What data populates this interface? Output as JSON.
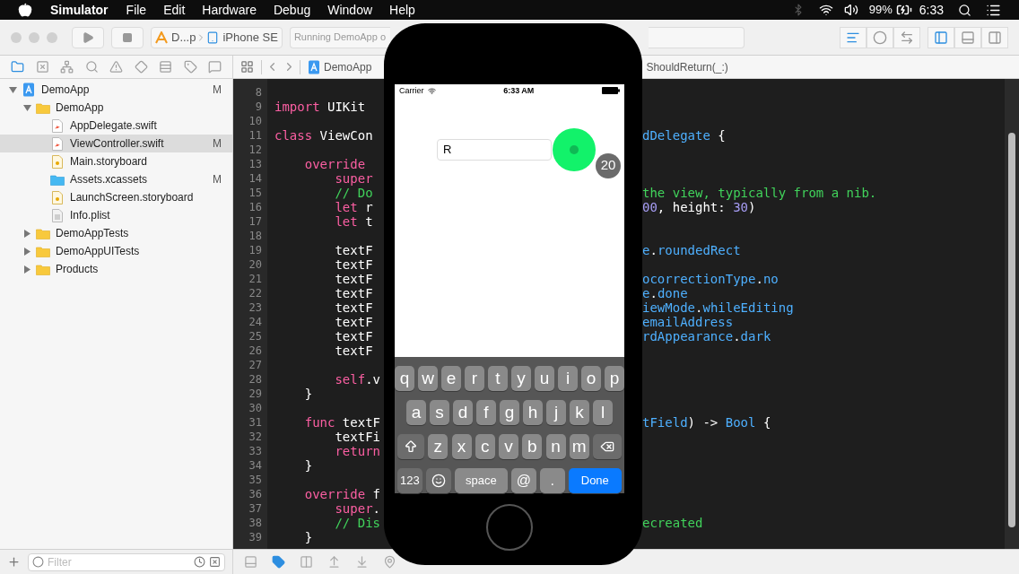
{
  "menu_bar": {
    "app": "Simulator",
    "menus": [
      "File",
      "Edit",
      "Hardware",
      "Debug",
      "Window",
      "Help"
    ],
    "battery_percent": "99%",
    "clock": "6:33"
  },
  "toolbar": {
    "scheme": "D...p",
    "device": "iPhone SE",
    "activity": "Running DemoApp o",
    "editor_modes": [
      {
        "selected": true
      },
      {
        "selected": false
      },
      {
        "selected": false
      }
    ],
    "panels": [
      {
        "selected": true
      },
      {
        "selected": false
      },
      {
        "selected": false
      }
    ]
  },
  "navigator_tabs": [
    {
      "selected": true
    },
    {
      "selected": false
    },
    {
      "selected": false
    },
    {
      "selected": false
    },
    {
      "selected": false
    },
    {
      "selected": false
    },
    {
      "selected": false
    },
    {
      "selected": false
    },
    {
      "selected": false
    }
  ],
  "jump_bar": {
    "crumbs": [
      "DemoApp",
      "ShouldReturn(_:)"
    ]
  },
  "project_tree": [
    {
      "name": "DemoApp",
      "kind": "project",
      "badge": "M",
      "selected": false,
      "expanded": true,
      "children": [
        {
          "name": "DemoApp",
          "kind": "folder",
          "selected": false,
          "expanded": true,
          "children": [
            {
              "name": "AppDelegate.swift",
              "kind": "swift",
              "selected": false
            },
            {
              "name": "ViewController.swift",
              "kind": "swift",
              "badge": "M",
              "selected": true
            },
            {
              "name": "Main.storyboard",
              "kind": "storyboard",
              "selected": false
            },
            {
              "name": "Assets.xcassets",
              "kind": "assets",
              "badge": "M",
              "selected": false
            },
            {
              "name": "LaunchScreen.storyboard",
              "kind": "storyboard",
              "selected": false
            },
            {
              "name": "Info.plist",
              "kind": "plist",
              "selected": false
            }
          ]
        },
        {
          "name": "DemoAppTests",
          "kind": "folder",
          "selected": false,
          "expanded": false
        },
        {
          "name": "DemoAppUITests",
          "kind": "folder",
          "selected": false,
          "expanded": false
        },
        {
          "name": "Products",
          "kind": "folder",
          "selected": false,
          "expanded": false
        }
      ]
    }
  ],
  "filter": {
    "placeholder": "Filter"
  },
  "editor": {
    "lines": [
      {
        "number": "8"
      },
      {
        "number": "9",
        "left": [
          {
            "text": "import",
            "kind": "keyword"
          },
          {
            "text": " UIKit",
            "kind": "plain"
          }
        ]
      },
      {
        "number": "10"
      },
      {
        "number": "11",
        "left": [
          {
            "text": "class",
            "kind": "keyword"
          },
          {
            "text": " ViewCon",
            "kind": "plain"
          }
        ],
        "right": [
          {
            "text": "dDelegate",
            "kind": "type"
          },
          {
            "text": " {",
            "kind": "plain"
          }
        ]
      },
      {
        "number": "12"
      },
      {
        "number": "13",
        "left": [
          {
            "text": "    override",
            "kind": "keyword"
          }
        ]
      },
      {
        "number": "14",
        "left": [
          {
            "text": "        super",
            "kind": "keyword"
          }
        ]
      },
      {
        "number": "15",
        "left": [
          {
            "text": "        // Do",
            "kind": "comment"
          }
        ],
        "right": [
          {
            "text": "the view, typically from a nib.",
            "kind": "comment"
          }
        ]
      },
      {
        "number": "16",
        "left": [
          {
            "text": "        let",
            "kind": "keyword"
          },
          {
            "text": " r",
            "kind": "plain"
          }
        ],
        "right": [
          {
            "text": "00",
            "kind": "number"
          },
          {
            "text": ", height: ",
            "kind": "plain"
          },
          {
            "text": "30",
            "kind": "number"
          },
          {
            "text": ")",
            "kind": "plain"
          }
        ]
      },
      {
        "number": "17",
        "left": [
          {
            "text": "        let",
            "kind": "keyword"
          },
          {
            "text": " t",
            "kind": "plain"
          }
        ]
      },
      {
        "number": "18"
      },
      {
        "number": "19",
        "left": [
          {
            "text": "        textF",
            "kind": "plain"
          }
        ],
        "right": [
          {
            "text": "e",
            "kind": "type"
          },
          {
            "text": ".",
            "kind": "plain"
          },
          {
            "text": "roundedRect",
            "kind": "type"
          }
        ]
      },
      {
        "number": "20",
        "left": [
          {
            "text": "        textF",
            "kind": "plain"
          }
        ]
      },
      {
        "number": "21",
        "left": [
          {
            "text": "        textF",
            "kind": "plain"
          }
        ],
        "right": [
          {
            "text": "ocorrectionType",
            "kind": "type"
          },
          {
            "text": ".",
            "kind": "plain"
          },
          {
            "text": "no",
            "kind": "type"
          }
        ]
      },
      {
        "number": "22",
        "left": [
          {
            "text": "        textF",
            "kind": "plain"
          }
        ],
        "right": [
          {
            "text": "e",
            "kind": "type"
          },
          {
            "text": ".",
            "kind": "plain"
          },
          {
            "text": "done",
            "kind": "type"
          }
        ]
      },
      {
        "number": "23",
        "left": [
          {
            "text": "        textF",
            "kind": "plain"
          }
        ],
        "right": [
          {
            "text": "iewMode",
            "kind": "type"
          },
          {
            "text": ".",
            "kind": "plain"
          },
          {
            "text": "whileEditing",
            "kind": "type"
          }
        ]
      },
      {
        "number": "24",
        "left": [
          {
            "text": "        textF",
            "kind": "plain"
          }
        ],
        "right": [
          {
            "text": "emailAddress",
            "kind": "type"
          }
        ]
      },
      {
        "number": "25",
        "left": [
          {
            "text": "        textF",
            "kind": "plain"
          }
        ],
        "right": [
          {
            "text": "rdAppearance",
            "kind": "type"
          },
          {
            "text": ".",
            "kind": "plain"
          },
          {
            "text": "dark",
            "kind": "type"
          }
        ]
      },
      {
        "number": "26",
        "left": [
          {
            "text": "        textF",
            "kind": "plain"
          }
        ]
      },
      {
        "number": "27"
      },
      {
        "number": "28",
        "left": [
          {
            "text": "        self",
            "kind": "keyword"
          },
          {
            "text": ".v",
            "kind": "plain"
          }
        ]
      },
      {
        "number": "29",
        "left": [
          {
            "text": "    }",
            "kind": "plain"
          }
        ]
      },
      {
        "number": "30"
      },
      {
        "number": "31",
        "left": [
          {
            "text": "    func",
            "kind": "keyword"
          },
          {
            "text": " textF",
            "kind": "plain"
          }
        ],
        "right": [
          {
            "text": "tField",
            "kind": "type"
          },
          {
            "text": ") -> ",
            "kind": "plain"
          },
          {
            "text": "Bool",
            "kind": "type"
          },
          {
            "text": " {",
            "kind": "plain"
          }
        ]
      },
      {
        "number": "32",
        "left": [
          {
            "text": "        textFi",
            "kind": "plain"
          }
        ]
      },
      {
        "number": "33",
        "left": [
          {
            "text": "        return",
            "kind": "keyword"
          }
        ]
      },
      {
        "number": "34",
        "left": [
          {
            "text": "    }",
            "kind": "plain"
          }
        ]
      },
      {
        "number": "35"
      },
      {
        "number": "36",
        "left": [
          {
            "text": "    override",
            "kind": "keyword"
          },
          {
            "text": " f",
            "kind": "plain"
          }
        ]
      },
      {
        "number": "37",
        "left": [
          {
            "text": "        super",
            "kind": "keyword"
          },
          {
            "text": ".",
            "kind": "plain"
          }
        ]
      },
      {
        "number": "38",
        "left": [
          {
            "text": "        // Dis",
            "kind": "comment"
          }
        ],
        "right": [
          {
            "text": "ecreated",
            "kind": "comment"
          }
        ]
      },
      {
        "number": "39",
        "left": [
          {
            "text": "    }",
            "kind": "plain"
          }
        ]
      }
    ]
  },
  "debug_bar": {
    "breakpoints_active": true
  },
  "simulator": {
    "carrier": "Carrier",
    "time": "6:33 AM",
    "text_field": {
      "value": "R"
    },
    "touch_indicator": {
      "step": "20"
    },
    "keyboard": {
      "rows": [
        {
          "keys": [
            {
              "kind": "letter",
              "label": "q"
            },
            {
              "kind": "letter",
              "label": "w"
            },
            {
              "kind": "letter",
              "label": "e"
            },
            {
              "kind": "letter",
              "label": "r"
            },
            {
              "kind": "letter",
              "label": "t"
            },
            {
              "kind": "letter",
              "label": "y"
            },
            {
              "kind": "letter",
              "label": "u"
            },
            {
              "kind": "letter",
              "label": "i"
            },
            {
              "kind": "letter",
              "label": "o"
            },
            {
              "kind": "letter",
              "label": "p"
            }
          ]
        },
        {
          "keys": [
            {
              "kind": "letter",
              "label": "a"
            },
            {
              "kind": "letter",
              "label": "s"
            },
            {
              "kind": "letter",
              "label": "d"
            },
            {
              "kind": "letter",
              "label": "f"
            },
            {
              "kind": "letter",
              "label": "g"
            },
            {
              "kind": "letter",
              "label": "h"
            },
            {
              "kind": "letter",
              "label": "j"
            },
            {
              "kind": "letter",
              "label": "k"
            },
            {
              "kind": "letter",
              "label": "l"
            }
          ]
        },
        {
          "keys": [
            {
              "kind": "shift"
            },
            {
              "kind": "letter",
              "label": "z"
            },
            {
              "kind": "letter",
              "label": "x"
            },
            {
              "kind": "letter",
              "label": "c"
            },
            {
              "kind": "letter",
              "label": "v"
            },
            {
              "kind": "letter",
              "label": "b"
            },
            {
              "kind": "letter",
              "label": "n"
            },
            {
              "kind": "letter",
              "label": "m"
            },
            {
              "kind": "delete"
            }
          ]
        },
        {
          "keys": [
            {
              "kind": "mode",
              "label": "123"
            },
            {
              "kind": "emoji"
            },
            {
              "kind": "space",
              "label": "space"
            },
            {
              "kind": "symbol",
              "label": "@"
            },
            {
              "kind": "symbol",
              "label": "."
            },
            {
              "kind": "return",
              "label": "Done"
            }
          ]
        }
      ]
    }
  }
}
